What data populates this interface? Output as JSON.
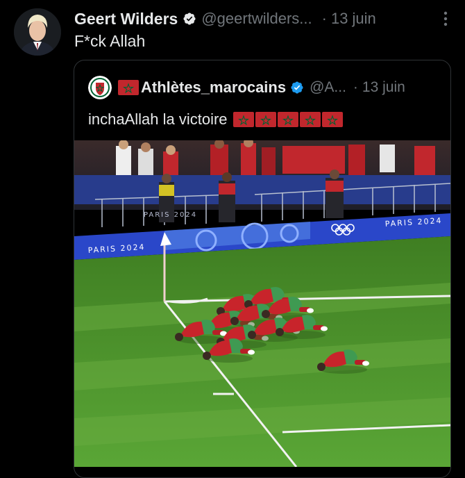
{
  "tweet": {
    "author_name": "Geert Wilders",
    "handle": "@geertwilders...",
    "separator": "·",
    "time": "13 juin",
    "text": "F*ck Allah",
    "icons": {
      "avatar": "profile-photo",
      "verified": "verified-badge-icon",
      "more": "more-options-icon"
    }
  },
  "quoted_tweet": {
    "author_name": "Athlètes_marocains",
    "handle": "@A...",
    "separator": "·",
    "time": "13 juin",
    "text": "inchaAllah la victoire",
    "flag_count": 5,
    "icons": {
      "avatar": "federation-crest-avatar",
      "flag": "morocco-flag-emoji",
      "verified": "verified-badge-icon"
    }
  },
  "photo": {
    "banners": [
      "PARIS 2024",
      "PARIS 2024",
      "PARIS 2024"
    ]
  },
  "colors": {
    "background": "#000000",
    "text_primary": "#e7e9ea",
    "text_secondary": "#71767b",
    "verified_blue": "#1d9bf0",
    "border": "#2f3336",
    "flag_red": "#c1272d",
    "flag_green": "#006233",
    "pitch_green": "#4f9a2e"
  }
}
